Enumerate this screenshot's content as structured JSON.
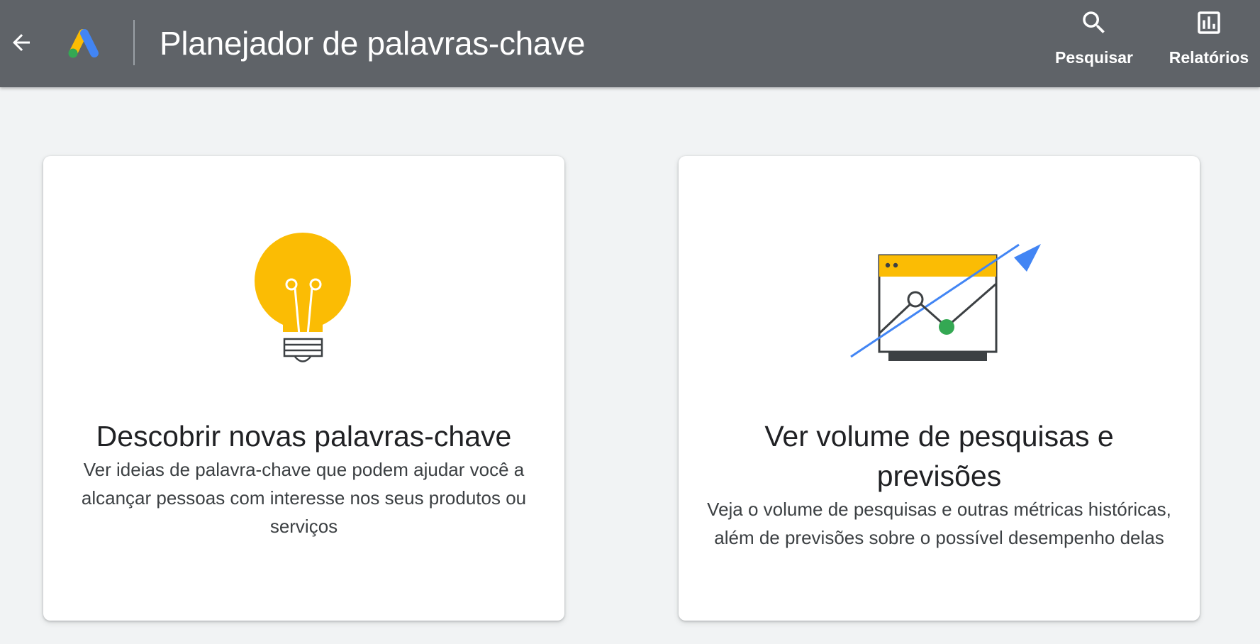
{
  "header": {
    "title": "Planejador de palavras-chave",
    "back_icon": "arrow-back-icon",
    "logo_icon": "google-ads-logo",
    "actions": [
      {
        "label": "Pesquisar",
        "icon": "search-icon"
      },
      {
        "label": "Relatórios",
        "icon": "bar-chart-icon"
      }
    ]
  },
  "cards": [
    {
      "title": "Descobrir novas palavras-chave",
      "description": "Ver ideias de palavra-chave que podem ajudar você a alcançar pessoas com interesse nos seus produtos ou serviços",
      "illustration": "lightbulb-icon"
    },
    {
      "title": "Ver volume de pesquisas e previsões",
      "description": "Veja o volume de pesquisas e outras métricas históricas, além de previsões sobre o possível desempenho delas",
      "illustration": "trend-chart-icon"
    }
  ],
  "colors": {
    "header_bg": "#5f6368",
    "page_bg": "#f1f3f4",
    "google_yellow": "#fbbc04",
    "google_blue": "#4285f4",
    "google_green": "#34a853"
  }
}
